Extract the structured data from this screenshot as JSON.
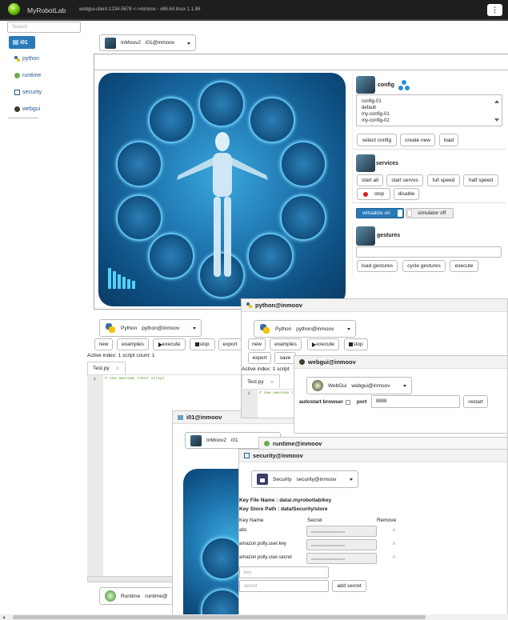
{
  "colors": {
    "topbar": "#1e1e1e",
    "accent": "#2a7ab8",
    "stop_dot": "#d92020"
  },
  "app": {
    "title": "MyRobotLab",
    "connection": "webgui-client-1234-5678 <->inmoov - x86.64.linux 1.1.86"
  },
  "sidebar": {
    "search_placeholder": "Search",
    "items": [
      {
        "label": "i01",
        "icon": "inmoov-icon"
      },
      {
        "label": "python",
        "icon": "python-icon"
      },
      {
        "label": "runtime",
        "icon": "runtime-icon"
      },
      {
        "label": "security",
        "icon": "security-icon"
      },
      {
        "label": "webgui",
        "icon": "webgui-icon"
      }
    ]
  },
  "main": {
    "service_select": {
      "type": "InMoov2",
      "name": "i01@inmoov"
    }
  },
  "config": {
    "title": "config",
    "list": [
      "config-01",
      "default",
      "my-config-01",
      "my-config-02"
    ],
    "buttons": [
      "select config",
      "create new",
      "load"
    ]
  },
  "services": {
    "title": "services",
    "buttons": [
      "start all",
      "start servos",
      "full speed",
      "half speed",
      "stop",
      "disable"
    ]
  },
  "virtualize": {
    "on_label": "virtualize on",
    "off_label": "simulator off"
  },
  "gestures": {
    "title": "gestures",
    "buttons": [
      "load gestures",
      "cycle gestures",
      "execute"
    ]
  },
  "python_main": {
    "select_type": "Python",
    "select_name": "python@inmoov",
    "toolbar": [
      "new",
      "examples",
      "execute",
      "stop",
      "export"
    ],
    "active_index": "Active index: 1 script count: 1",
    "tab": "Test.py",
    "line": "1",
    "code": "# new awesome robot script"
  },
  "python_panel": {
    "title": "python@inmoov",
    "select_type": "Python",
    "select_name": "python@inmoov",
    "toolbar": [
      "new",
      "examples",
      "execute",
      "stop"
    ],
    "row2": [
      "export",
      "save"
    ],
    "active_index": "Active index: 1 script",
    "tab": "Test.py",
    "line": "1",
    "code": "# new awesome r"
  },
  "webgui_panel": {
    "title": "webgui@inmoov",
    "select_type": "WebGui",
    "select_name": "webgui@inmoov",
    "autostart": "autostart browser",
    "port_label": "port",
    "port": "8888",
    "restart": "restart"
  },
  "i01_panel": {
    "title": "i01@inmoov",
    "select_type": "InMoov2",
    "select_name": "i01"
  },
  "runtime_panel": {
    "title": "runtime@inmoov"
  },
  "runtime_bottom": {
    "select_type": "Runtime",
    "select_name": "runtime@"
  },
  "security_panel": {
    "title": "security@inmoov",
    "select_type": "Security",
    "select_name": "security@inmoov",
    "key_file": "Key File Name : data/.myrobotlab/key",
    "key_store": "Key Store Path : data/Security/store",
    "cols": [
      "Key Name",
      "Secret",
      "Remove"
    ],
    "rows": [
      {
        "name": "abc",
        "secret": "••••••••••••••••••••••••••••••"
      },
      {
        "name": "amazon.polly.user.key",
        "secret": "••••••••••••••••••••••••••••••"
      },
      {
        "name": "amazon.polly.user.secret",
        "secret": "••••••••••••••••••••••••••••••"
      }
    ],
    "key_placeholder": "key",
    "secret_placeholder": "secret",
    "add_label": "add secret"
  }
}
